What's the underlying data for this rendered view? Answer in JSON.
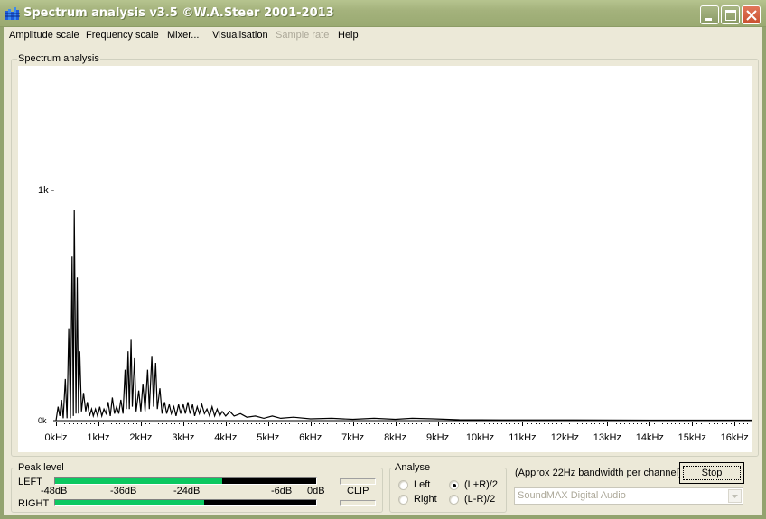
{
  "window": {
    "title": "Spectrum analysis v3.5  ©W.A.Steer 2001-2013",
    "app_icon": "spectrum-bars-icon",
    "controls": [
      "minimize",
      "maximize",
      "close"
    ]
  },
  "menu": [
    {
      "label": "Amplitude scale",
      "enabled": true
    },
    {
      "label": "Frequency scale",
      "enabled": true
    },
    {
      "label": "Mixer...",
      "enabled": true
    },
    {
      "label": "Visualisation",
      "enabled": true
    },
    {
      "label": "Sample rate",
      "enabled": false
    },
    {
      "label": "Help",
      "enabled": true
    }
  ],
  "spectrum_panel": {
    "label": "Spectrum analysis"
  },
  "chart_data": {
    "type": "line",
    "title": "Spectrum analysis",
    "xlabel": "",
    "ylabel": "",
    "x_unit": "kHz",
    "xlim": [
      0,
      16.5
    ],
    "ylim": [
      0,
      1.0
    ],
    "y_ticks": [
      {
        "value": 0,
        "label": "0k"
      },
      {
        "value": 1,
        "label": "1k -"
      }
    ],
    "x_ticks": [
      "0kHz",
      "1kHz",
      "2kHz",
      "3kHz",
      "4kHz",
      "5kHz",
      "6kHz",
      "7kHz",
      "8kHz",
      "9kHz",
      "10kHz",
      "11kHz",
      "12kHz",
      "13kHz",
      "14kHz",
      "15kHz",
      "16kHz"
    ],
    "minor_ticks_per_kHz": 10,
    "grid": false,
    "series": [
      {
        "name": "(L+R)/2",
        "peaks_kHz": [
          [
            0.05,
            0.06
          ],
          [
            0.09,
            0.02
          ],
          [
            0.13,
            0.09
          ],
          [
            0.17,
            0.01
          ],
          [
            0.22,
            0.18
          ],
          [
            0.26,
            0.01
          ],
          [
            0.3,
            0.4
          ],
          [
            0.34,
            0.01
          ],
          [
            0.38,
            0.71
          ],
          [
            0.41,
            0.02
          ],
          [
            0.43,
            0.91
          ],
          [
            0.47,
            0.03
          ],
          [
            0.5,
            0.62
          ],
          [
            0.53,
            0.03
          ],
          [
            0.56,
            0.3
          ],
          [
            0.6,
            0.04
          ],
          [
            0.65,
            0.12
          ],
          [
            0.7,
            0.04
          ],
          [
            0.74,
            0.08
          ],
          [
            0.79,
            0.02
          ],
          [
            0.84,
            0.05
          ],
          [
            0.88,
            0.02
          ],
          [
            0.93,
            0.05
          ],
          [
            0.98,
            0.02
          ],
          [
            1.03,
            0.06
          ],
          [
            1.08,
            0.02
          ],
          [
            1.13,
            0.05
          ],
          [
            1.18,
            0.03
          ],
          [
            1.23,
            0.08
          ],
          [
            1.28,
            0.02
          ],
          [
            1.33,
            0.1
          ],
          [
            1.38,
            0.03
          ],
          [
            1.43,
            0.06
          ],
          [
            1.48,
            0.03
          ],
          [
            1.53,
            0.09
          ],
          [
            1.58,
            0.03
          ],
          [
            1.63,
            0.22
          ],
          [
            1.66,
            0.05
          ],
          [
            1.7,
            0.3
          ],
          [
            1.73,
            0.05
          ],
          [
            1.77,
            0.35
          ],
          [
            1.8,
            0.06
          ],
          [
            1.85,
            0.27
          ],
          [
            1.89,
            0.04
          ],
          [
            1.95,
            0.13
          ],
          [
            2.0,
            0.04
          ],
          [
            2.05,
            0.16
          ],
          [
            2.1,
            0.04
          ],
          [
            2.16,
            0.22
          ],
          [
            2.2,
            0.05
          ],
          [
            2.26,
            0.28
          ],
          [
            2.3,
            0.06
          ],
          [
            2.35,
            0.25
          ],
          [
            2.39,
            0.05
          ],
          [
            2.45,
            0.14
          ],
          [
            2.5,
            0.03
          ],
          [
            2.56,
            0.08
          ],
          [
            2.61,
            0.03
          ],
          [
            2.67,
            0.07
          ],
          [
            2.72,
            0.03
          ],
          [
            2.78,
            0.06
          ],
          [
            2.83,
            0.02
          ],
          [
            2.89,
            0.07
          ],
          [
            2.94,
            0.03
          ],
          [
            3.0,
            0.07
          ],
          [
            3.05,
            0.03
          ],
          [
            3.11,
            0.08
          ],
          [
            3.16,
            0.03
          ],
          [
            3.22,
            0.07
          ],
          [
            3.27,
            0.02
          ],
          [
            3.33,
            0.06
          ],
          [
            3.38,
            0.03
          ],
          [
            3.44,
            0.07
          ],
          [
            3.5,
            0.03
          ],
          [
            3.56,
            0.05
          ],
          [
            3.62,
            0.02
          ],
          [
            3.68,
            0.06
          ],
          [
            3.74,
            0.02
          ],
          [
            3.8,
            0.05
          ],
          [
            3.86,
            0.02
          ],
          [
            3.92,
            0.04
          ],
          [
            4.0,
            0.02
          ],
          [
            4.1,
            0.04
          ],
          [
            4.2,
            0.02
          ],
          [
            4.35,
            0.03
          ],
          [
            4.5,
            0.015
          ],
          [
            4.7,
            0.02
          ],
          [
            4.9,
            0.01
          ],
          [
            5.1,
            0.02
          ],
          [
            5.3,
            0.01
          ],
          [
            5.6,
            0.015
          ],
          [
            6.0,
            0.008
          ],
          [
            6.5,
            0.01
          ],
          [
            7.0,
            0.006
          ],
          [
            7.5,
            0.01
          ],
          [
            8.0,
            0.006
          ],
          [
            8.4,
            0.01
          ],
          [
            8.9,
            0.008
          ],
          [
            9.5,
            0.004
          ],
          [
            10.5,
            0.003
          ],
          [
            12.0,
            0.003
          ],
          [
            14.0,
            0.002
          ],
          [
            16.5,
            0.002
          ]
        ]
      }
    ]
  },
  "peak_level": {
    "label": "Peak level",
    "left_label": "LEFT",
    "right_label": "RIGHT",
    "left_fill_fraction": 0.64,
    "right_fill_fraction": 0.57,
    "scale": [
      {
        "label": "-48dB",
        "db": -48
      },
      {
        "label": "-36dB",
        "db": -36
      },
      {
        "label": "-24dB",
        "db": -24
      },
      {
        "label": "-6dB",
        "db": -6
      },
      {
        "label": "0dB",
        "db": 0
      }
    ],
    "clip_label": "CLIP"
  },
  "analyse": {
    "label": "Analyse",
    "options": [
      {
        "label": "Left",
        "checked": false
      },
      {
        "label": "Right",
        "checked": false
      },
      {
        "label": "(L+R)/2",
        "checked": true
      },
      {
        "label": "(L-R)/2",
        "checked": false
      }
    ]
  },
  "bandwidth_text": "(Approx 22Hz bandwidth per channel)",
  "stop_button": {
    "label": "Stop",
    "accel": "S"
  },
  "device_select": {
    "value": "SoundMAX Digital Audio",
    "enabled": false
  }
}
